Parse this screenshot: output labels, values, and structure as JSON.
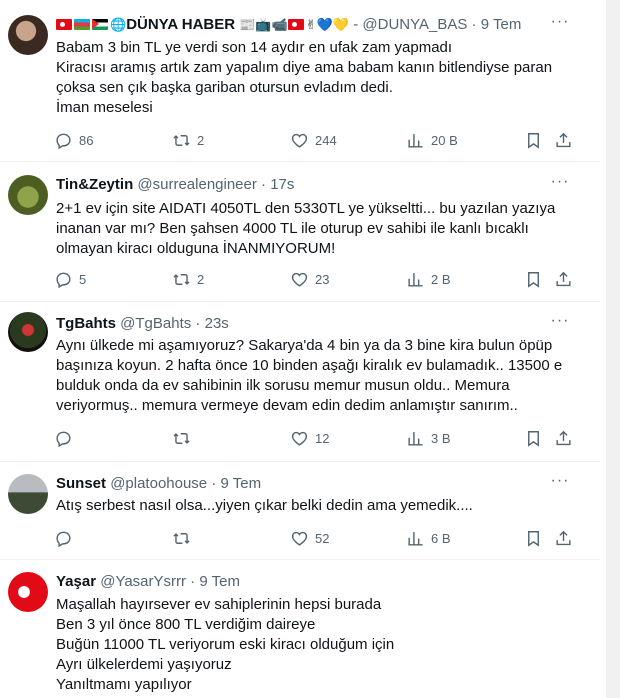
{
  "tweets": [
    {
      "name": "DÜNYA HABER",
      "handle": "@DUNYA_BAS",
      "time": "9 Tem",
      "lines": [
        "Babam 3 bin TL ye verdi son 14 aydır en ufak zam yapmadı",
        "Kiracısı aramış artık zam yapalım diye ama babam kanın bitlendiyse paran",
        "çoksa sen çık başka gariban otursun evladım dedi.",
        "İman meselesi"
      ],
      "replies": "86",
      "retweets": "2",
      "likes": "244",
      "views": "20 B"
    },
    {
      "name": "Tin&Zeytin",
      "handle": "@surrealengineer",
      "time": "17s",
      "lines": [
        "2+1 ev için site AIDATI 4050TL den 5330TL ye yükseltti... bu yazılan yazıya",
        "inanan var mı? Ben şahsen 4000 TL ile oturup ev sahibi ile kanlı bıcaklı",
        "olmayan kiracı olduguna İNANMIYORUM!"
      ],
      "replies": "5",
      "retweets": "2",
      "likes": "23",
      "views": "2 B"
    },
    {
      "name": "TgBahts",
      "handle": "@TgBahts",
      "time": "23s",
      "lines": [
        "Aynı ülkede mi aşamıyoruz? Sakarya'da 4 bin ya da 3 bine kira bulun öpüp",
        "başınıza koyun. 2 hafta önce 10 binden aşağı kiralık ev bulamadık.. 13500 e",
        "bulduk onda da ev sahibinin ilk sorusu memur musun oldu.. Memura",
        "veriyormuş.. memura vermeye devam edin dedim anlamıştır sanırım.."
      ],
      "replies": "",
      "retweets": "",
      "likes": "12",
      "views": "3 B"
    },
    {
      "name": "Sunset",
      "handle": "@platoohouse",
      "time": "9 Tem",
      "lines": [
        "Atış serbest nasıl olsa...yiyen çıkar belki dedin ama yemedik...."
      ],
      "replies": "",
      "retweets": "",
      "likes": "52",
      "views": "6 B"
    },
    {
      "name": "Yaşar",
      "handle": "@YasarYsrrr",
      "time": "9 Tem",
      "lines": [
        "Maşallah hayırsever ev sahiplerinin hepsi burada",
        "Ben 3 yıl önce 800 TL verdiğim daireye",
        "Buğün 11000 TL veriyorum eski kiracı olduğum için",
        "Ayrı ülkelerdemi yaşıyoruz",
        "Yanıltmamı yapılıyor"
      ]
    }
  ],
  "icons": {
    "reply": "reply-icon",
    "retweet": "retweet-icon",
    "like": "like-icon",
    "views": "views-icon",
    "bookmark": "bookmark-icon",
    "share": "share-icon",
    "more": "more-icon"
  },
  "colors": {
    "text": "#0f1419",
    "muted": "#536471",
    "divider": "#eff3f4"
  }
}
